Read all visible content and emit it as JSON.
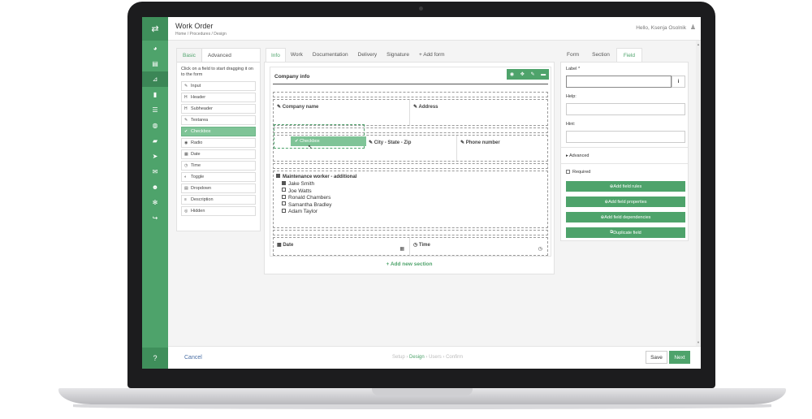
{
  "header": {
    "title": "Work Order",
    "breadcrumb": "Home / Procedures / Design",
    "greeting": "Hello, Ksenja Osolnik"
  },
  "sidebar": {
    "icons": [
      "swap-icon",
      "dashboard-icon",
      "document-icon",
      "sitemap-icon",
      "book-icon",
      "list-icon",
      "globe-icon",
      "truck-icon",
      "send-icon",
      "mail-icon",
      "users-icon",
      "gear-icon",
      "share-icon",
      "help-icon"
    ]
  },
  "left_panel": {
    "tabs": [
      "Basic",
      "Advanced"
    ],
    "hint": "Click on a field to start dragging it on to the form",
    "fields": [
      {
        "icon": "✎",
        "label": "Input"
      },
      {
        "icon": "H",
        "label": "Header"
      },
      {
        "icon": "H",
        "label": "Subheader"
      },
      {
        "icon": "✎",
        "label": "Textarea"
      },
      {
        "icon": "✔",
        "label": "Checkbox"
      },
      {
        "icon": "◉",
        "label": "Radio"
      },
      {
        "icon": "▦",
        "label": "Date"
      },
      {
        "icon": "◷",
        "label": "Time"
      },
      {
        "icon": "◐",
        "label": "Toggle"
      },
      {
        "icon": "▤",
        "label": "Dropdown"
      },
      {
        "icon": "≡",
        "label": "Description"
      },
      {
        "icon": "◎",
        "label": "Hidden"
      }
    ]
  },
  "form_tabs": [
    "Info",
    "Work",
    "Documentation",
    "Delivery",
    "Signature",
    "+ Add form"
  ],
  "section": {
    "title": "Company info",
    "row1": [
      "Company name",
      "Address"
    ],
    "row2": [
      "City - State - Zip",
      "Phone number"
    ],
    "workers_title": "Maintenance worker - additional",
    "workers": [
      {
        "name": "Jake Smith",
        "checked": true
      },
      {
        "name": "Joe Watts",
        "checked": false
      },
      {
        "name": "Ronald Chambers",
        "checked": false
      },
      {
        "name": "Samantha Bradley",
        "checked": false
      },
      {
        "name": "Adam Taylor",
        "checked": false
      }
    ],
    "row3": [
      "Date",
      "Time"
    ],
    "dragging": "Checkbox",
    "add_section": "+ Add new section"
  },
  "right_panel": {
    "tabs": [
      "Form",
      "Section",
      "Field"
    ],
    "label": "Label *",
    "help": "Help:",
    "hint": "Hint:",
    "advanced": "Advanced",
    "required": "Required",
    "buttons": [
      "Add field rules",
      "Add field properties",
      "Add field dependencies",
      "Duplicate field"
    ]
  },
  "footer": {
    "cancel": "Cancel",
    "steps": [
      "Setup",
      "Design",
      "Users",
      "Confirm"
    ],
    "save": "Save",
    "next": "Next"
  },
  "colors": {
    "accent": "#4ea36b",
    "accent_light": "#7fc497"
  }
}
